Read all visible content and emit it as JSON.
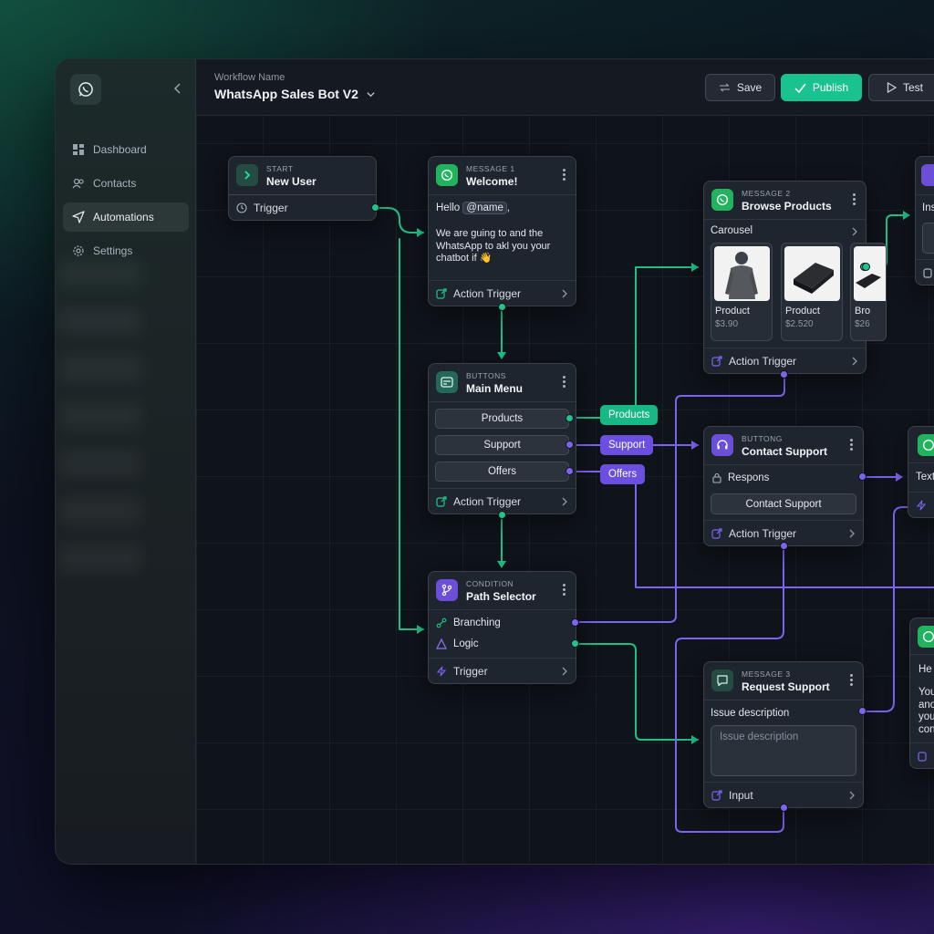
{
  "sidebar": {
    "items": [
      {
        "label": "Dashboard"
      },
      {
        "label": "Contacts"
      },
      {
        "label": "Automations"
      },
      {
        "label": "Settings"
      }
    ]
  },
  "header": {
    "workflow_label": "Workflow Name",
    "workflow_name": "WhatsApp Sales Bot V2",
    "save": "Save",
    "publish": "Publish",
    "test": "Test"
  },
  "colors": {
    "green": "#19c28e",
    "purple": "#6b4fd8"
  },
  "nodes": {
    "start": {
      "type": "START",
      "title": "New User",
      "footer": "Trigger"
    },
    "message1": {
      "type": "MESSAGE 1",
      "title": "Welcome!",
      "hello": "Hello",
      "mention": "@name",
      "comma": ",",
      "body": "We are guing to and the WhatsApp to akl you your chatbot if 👋",
      "footer": "Action Trigger"
    },
    "buttons": {
      "type": "BUTTONS",
      "title": "Main Menu",
      "options": [
        "Products",
        "Support",
        "Offers"
      ],
      "footer": "Action Trigger"
    },
    "condition": {
      "type": "CONDITION",
      "title": "Path Selector",
      "row1": "Branching",
      "row2": "Logic",
      "footer": "Trigger"
    },
    "message2": {
      "type": "MESSAGE 2",
      "title": "Browse Products",
      "carousel": "Carousel",
      "products": [
        {
          "name": "Product",
          "price": "$3.90"
        },
        {
          "name": "Product",
          "price": "$2.520"
        },
        {
          "name": "Bro",
          "price": "$26"
        }
      ],
      "footer": "Action Trigger"
    },
    "support": {
      "type": "BUTTONG",
      "title": "Contact Support",
      "row": "Respons",
      "button": "Contact Support",
      "footer": "Action Trigger"
    },
    "message3": {
      "type": "MESSAGE 3",
      "title": "Request Support",
      "label": "Issue description",
      "placeholder": "Issue description",
      "footer": "Input"
    },
    "right_top": {
      "row": "Ins"
    },
    "right_mid": {
      "row": "Text"
    },
    "right_bottom": {
      "hello": "He",
      "lines": [
        "You",
        "ano",
        "you",
        "con"
      ]
    }
  },
  "tags": [
    "Products",
    "Support",
    "Offers"
  ]
}
